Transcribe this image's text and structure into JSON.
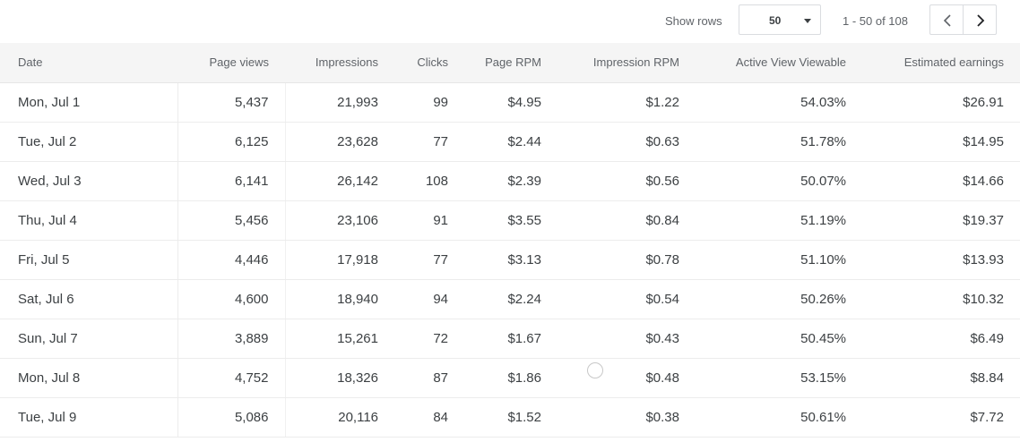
{
  "toolbar": {
    "show_rows_label": "Show rows",
    "rows_value": "50",
    "range_label": "1 - 50 of 108",
    "prev_icon": "chevron-left-icon",
    "next_icon": "chevron-right-icon"
  },
  "table": {
    "columns": [
      "Date",
      "Page views",
      "Impressions",
      "Clicks",
      "Page RPM",
      "Impression RPM",
      "Active View Viewable",
      "Estimated earnings"
    ],
    "rows": [
      [
        "Mon, Jul 1",
        "5,437",
        "21,993",
        "99",
        "$4.95",
        "$1.22",
        "54.03%",
        "$26.91"
      ],
      [
        "Tue, Jul 2",
        "6,125",
        "23,628",
        "77",
        "$2.44",
        "$0.63",
        "51.78%",
        "$14.95"
      ],
      [
        "Wed, Jul 3",
        "6,141",
        "26,142",
        "108",
        "$2.39",
        "$0.56",
        "50.07%",
        "$14.66"
      ],
      [
        "Thu, Jul 4",
        "5,456",
        "23,106",
        "91",
        "$3.55",
        "$0.84",
        "51.19%",
        "$19.37"
      ],
      [
        "Fri, Jul 5",
        "4,446",
        "17,918",
        "77",
        "$3.13",
        "$0.78",
        "51.10%",
        "$13.93"
      ],
      [
        "Sat, Jul 6",
        "4,600",
        "18,940",
        "94",
        "$2.24",
        "$0.54",
        "50.26%",
        "$10.32"
      ],
      [
        "Sun, Jul 7",
        "3,889",
        "15,261",
        "72",
        "$1.67",
        "$0.43",
        "50.45%",
        "$6.49"
      ],
      [
        "Mon, Jul 8",
        "4,752",
        "18,326",
        "87",
        "$1.86",
        "$0.48",
        "53.15%",
        "$8.84"
      ],
      [
        "Tue, Jul 9",
        "5,086",
        "20,116",
        "84",
        "$1.52",
        "$0.38",
        "50.61%",
        "$7.72"
      ]
    ]
  }
}
